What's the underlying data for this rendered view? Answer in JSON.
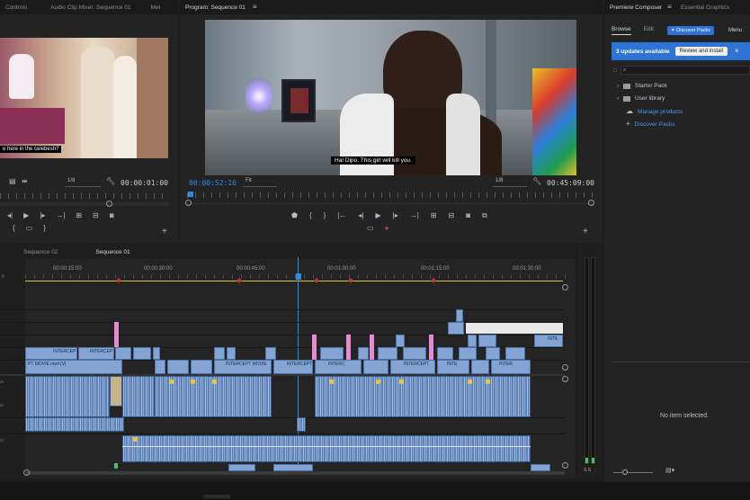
{
  "source_monitor": {
    "tabs": [
      "Controls",
      "Audio Clip Mixer: Sequence 01",
      "Met"
    ],
    "subtitle": "e here in the celebesh?",
    "zoom": "1/8",
    "timecode": "00:00:01:00"
  },
  "program_monitor": {
    "tab": "Program: Sequence 01",
    "subtitle": "Ha! Dipo. This girl will kill you.",
    "current_timecode": "00:00:52:16",
    "fit": "Fit",
    "zoom": "1/8",
    "duration": "00:45:09:00"
  },
  "timeline": {
    "tabs": [
      "Sequence 02",
      "Sequence 01"
    ],
    "ticks": [
      "00:00:15:00",
      "00:00:30:00",
      "00:00:45:00",
      "00:01:00:00",
      "00:01:15:00",
      "00:01:30:00"
    ],
    "playhead_timecode": "00:00:52:16",
    "clip_labels": {
      "intercept": "INTERCEPT",
      "intercept_movie": "INTERCEPT MOVIE",
      "movie_left": "PT MOVIE.mp4 [V]",
      "interc": "INTERC",
      "inte": "INTE",
      "inter": "INTER",
      "inter_short": "INTER",
      "inte_right": "INTE"
    }
  },
  "essentials": {
    "tabs": [
      "Premiere Composer",
      "Essential Graphics"
    ],
    "subtabs": [
      "Browse",
      "Edit"
    ],
    "discover_button": "Discover Packs",
    "menu": "Menu",
    "updates_text": "3 updates available",
    "review_button": "Review and install",
    "items": [
      {
        "label": "Starter Pack",
        "icon": "folder-icon"
      },
      {
        "label": "User library",
        "icon": "folder-icon"
      },
      {
        "label": "Manage products",
        "icon": "cloud-icon",
        "link": true
      },
      {
        "label": "Discover Packs",
        "icon": "plus-icon",
        "link": true
      }
    ],
    "no_item": "No item selected."
  },
  "colors": {
    "accent": "#2d8ceb",
    "clip_video": "#84a5d4",
    "clip_audio": "#5f83b8",
    "clip_pink": "#e38ad2",
    "playhead": "#2d8ceb"
  }
}
